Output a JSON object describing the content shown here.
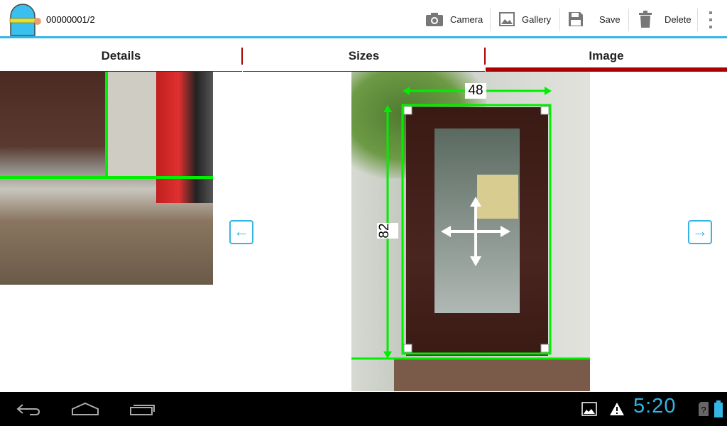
{
  "actionbar": {
    "title": "00000001/2",
    "actions": [
      {
        "label": "Camera",
        "icon": "camera-icon"
      },
      {
        "label": "Gallery",
        "icon": "gallery-icon"
      },
      {
        "label": "Save",
        "icon": "save-icon"
      },
      {
        "label": "Delete",
        "icon": "trash-icon"
      }
    ]
  },
  "tabs": [
    {
      "label": "Details"
    },
    {
      "label": "Sizes"
    },
    {
      "label": "Image",
      "selected": true
    }
  ],
  "image": {
    "width_label": "48",
    "height_label": "82"
  },
  "statusbar": {
    "time": "5:20"
  },
  "colors": {
    "accent": "#33b5e5",
    "tab_indicator": "#aa0000",
    "measure": "#00ee00"
  }
}
